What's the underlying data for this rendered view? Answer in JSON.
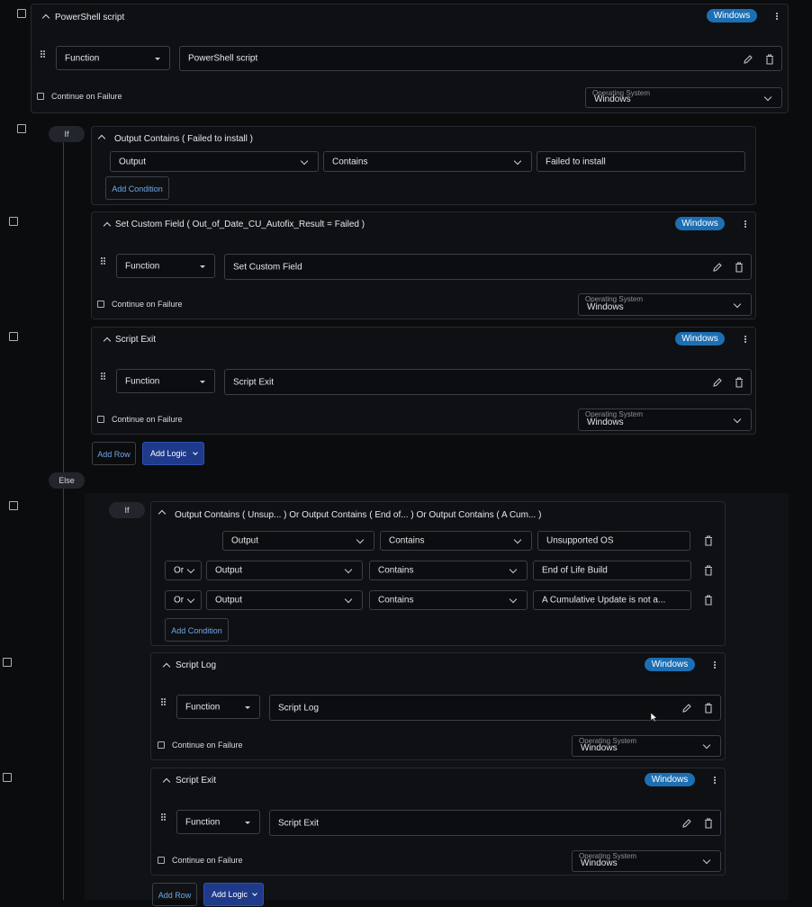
{
  "os_badge": "Windows",
  "function_label": "Function",
  "continue_on_failure": "Continue on Failure",
  "operating_system_label": "Operating System",
  "operating_system_value": "Windows",
  "if_label": "If",
  "else_label": "Else",
  "or_label": "Or",
  "add_condition": "Add Condition",
  "add_row": "Add Row",
  "add_logic": "Add Logic",
  "block1": {
    "title": "PowerShell script",
    "function_value": "PowerShell script"
  },
  "cond1": {
    "title": "Output Contains ( Failed to install )",
    "field": "Output",
    "operator": "Contains",
    "value": "Failed to install"
  },
  "block2": {
    "title": "Set Custom Field ( Out_of_Date_CU_Autofix_Result = Failed )",
    "function_value": "Set Custom Field"
  },
  "block3": {
    "title": "Script Exit",
    "function_value": "Script Exit"
  },
  "cond2": {
    "title": "Output Contains ( Unsup... ) Or Output Contains ( End of... ) Or Output Contains ( A Cum... )",
    "rows": [
      {
        "field": "Output",
        "operator": "Contains",
        "value": "Unsupported OS"
      },
      {
        "field": "Output",
        "operator": "Contains",
        "value": "End of Life Build"
      },
      {
        "field": "Output",
        "operator": "Contains",
        "value": "A Cumulative Update is not a..."
      }
    ]
  },
  "block4": {
    "title": "Script Log",
    "function_value": "Script Log"
  },
  "block5": {
    "title": "Script Exit",
    "function_value": "Script Exit"
  }
}
